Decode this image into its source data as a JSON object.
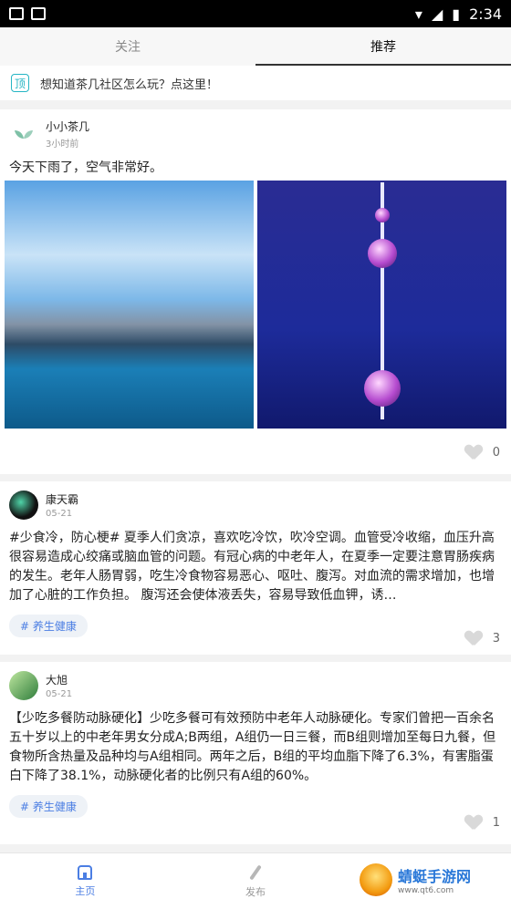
{
  "status": {
    "time": "2:34"
  },
  "tabs": [
    {
      "label": "关注",
      "active": false
    },
    {
      "label": "推荐",
      "active": true
    }
  ],
  "notice": {
    "badge": "顶",
    "text": "想知道茶几社区怎么玩？点这里！"
  },
  "posts": [
    {
      "author": "小小茶几",
      "time": "3小时前",
      "text": "今天下雨了，空气非常好。",
      "likes": "0"
    },
    {
      "author": "康天霸",
      "time": "05-21",
      "text": "#少食冷，防心梗# 夏季人们贪凉，喜欢吃冷饮，吹冷空调。血管受冷收缩，血压升高很容易造成心绞痛或脑血管的问题。有冠心病的中老年人，在夏季一定要注意胃肠疾病的发生。老年人肠胃弱，吃生冷食物容易恶心、呕吐、腹泻。对血流的需求增加，也增加了心脏的工作负担。 腹泻还会使体液丢失，容易导致低血钾，诱…",
      "tag": "# 养生健康",
      "likes": "3"
    },
    {
      "author": "大旭",
      "time": "05-21",
      "text": "【少吃多餐防动脉硬化】少吃多餐可有效预防中老年人动脉硬化。专家们曾把一百余名五十岁以上的中老年男女分成A;B两组，A组仍一日三餐，而B组则增加至每日九餐，但食物所含热量及品种均与A组相同。两年之后，B组的平均血脂下降了6.3%，有害脂蛋白下降了38.1%，动脉硬化者的比例只有A组的60%。",
      "tag": "# 养生健康",
      "likes": "1"
    }
  ],
  "nav": [
    {
      "label": "主页",
      "active": true
    },
    {
      "label": "发布",
      "active": false
    }
  ],
  "watermark": {
    "title": "蜻蜓手游网",
    "sub": "www.qt6.com"
  },
  "colors": {
    "accent": "#4b7ee3",
    "notice_badge": "#25b5c4"
  }
}
